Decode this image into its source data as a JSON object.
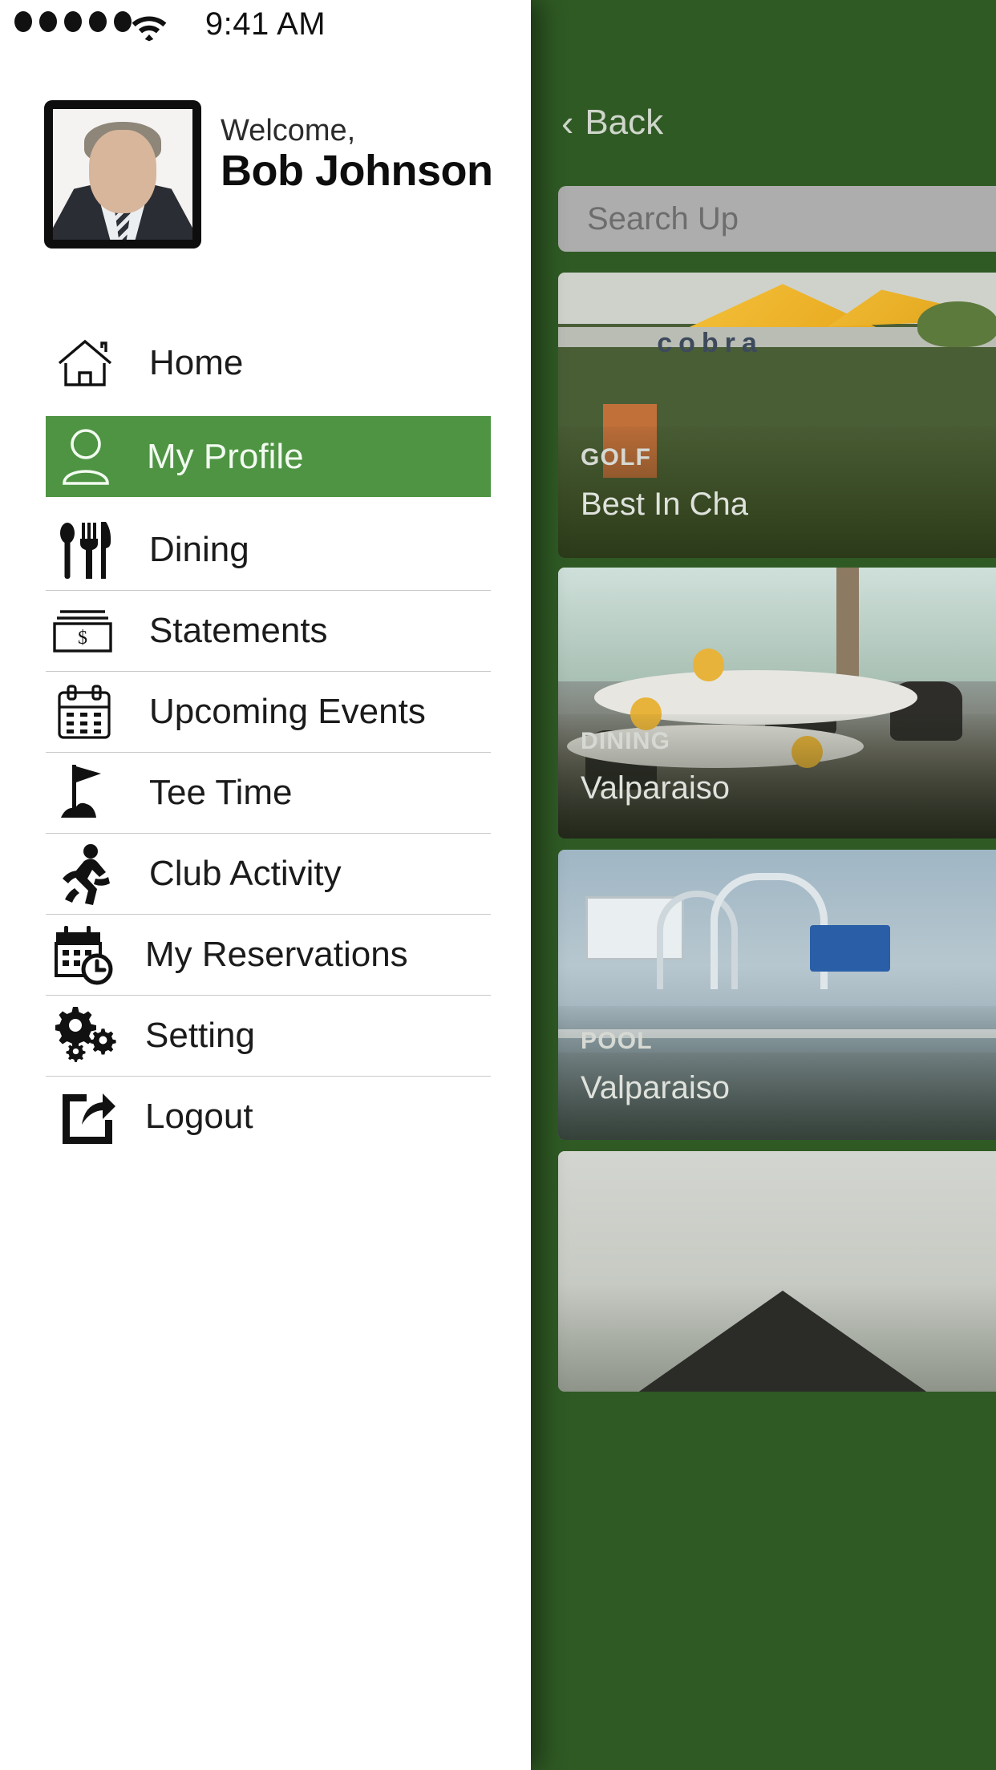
{
  "status_bar": {
    "signal_dots": 5,
    "wifi_icon": "wifi-icon",
    "time": "9:41 AM"
  },
  "drawer": {
    "profile": {
      "welcome_label": "Welcome,",
      "user_name": "Bob Johnson",
      "avatar_alt": "avatar"
    },
    "menu_items": [
      {
        "label": "Home",
        "icon": "home-icon",
        "active": false,
        "divider_below": false
      },
      {
        "label": "My Profile",
        "icon": "person-icon",
        "active": true,
        "divider_below": false
      },
      {
        "label": "Dining",
        "icon": "cutlery-icon",
        "active": false,
        "divider_below": true
      },
      {
        "label": "Statements",
        "icon": "money-bills-icon",
        "active": false,
        "divider_below": true
      },
      {
        "label": "Upcoming Events",
        "icon": "calendar-icon",
        "active": false,
        "divider_below": true
      },
      {
        "label": "Tee Time",
        "icon": "golf-flag-icon",
        "active": false,
        "divider_below": true
      },
      {
        "label": "Club Activity",
        "icon": "running-person-icon",
        "active": false,
        "divider_below": true
      },
      {
        "label": "My Reservations",
        "icon": "calendar-clock-icon",
        "active": false,
        "divider_below": true
      },
      {
        "label": "Setting",
        "icon": "gears-icon",
        "active": false,
        "divider_below": true
      },
      {
        "label": "Logout",
        "icon": "logout-icon",
        "active": false,
        "divider_below": false
      }
    ]
  },
  "main": {
    "back_label": "Back",
    "back_icon": "chevron-left-icon",
    "search_placeholder": "Search Up",
    "cards": [
      {
        "category": "GOLF",
        "title": "Best In Cha",
        "photo": "golf-tent-photo"
      },
      {
        "category": "DINING",
        "title": "Valparaiso",
        "photo": "dining-room-photo"
      },
      {
        "category": "POOL",
        "title": "Valparaiso",
        "photo": "pool-photo"
      },
      {
        "category": "",
        "title": "",
        "photo": "building-photo"
      }
    ]
  },
  "colors": {
    "accent_green": "#4E9443",
    "panel_green": "#2F5A24",
    "divider": "#c9c9c9",
    "search_bg": "#adadad",
    "text_dark": "#1b1b1b",
    "text_light": "#f2fbf0"
  }
}
